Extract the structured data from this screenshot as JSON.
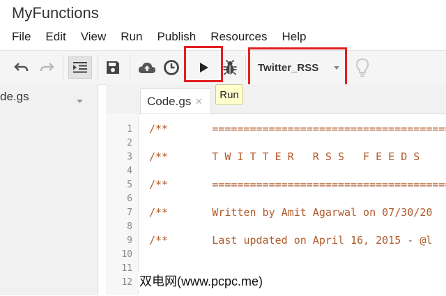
{
  "app": {
    "title": "MyFunctions"
  },
  "menu": [
    "File",
    "Edit",
    "View",
    "Run",
    "Publish",
    "Resources",
    "Help"
  ],
  "toolbar": {
    "undo_icon": "undo-icon",
    "redo_icon": "redo-icon",
    "indent_icon": "indent-icon",
    "save_icon": "save-icon",
    "cloud_icon": "cloud-upload-icon",
    "triggers_icon": "clock-icon",
    "run_icon": "play-icon",
    "debug_icon": "bug-icon",
    "function_select_value": "Twitter_RSS",
    "bulb_icon": "lightbulb-icon"
  },
  "tooltip": {
    "text": "Run"
  },
  "sidebar": {
    "file_label": "de.gs"
  },
  "tabs": [
    {
      "label": "Code.gs",
      "close": "×"
    }
  ],
  "code": {
    "line_numbers": [
      "1",
      "2",
      "3",
      "4",
      "5",
      "6",
      "7",
      "8",
      "9",
      "10",
      "11",
      "12"
    ],
    "lines": [
      "/**       =======================================",
      "",
      "/**       T W I T T E R   R S S   F E E D S",
      "",
      "/**       =======================================",
      "",
      "/**       Written by Amit Agarwal on 07/30/20",
      "",
      "/**       Last updated on April 16, 2015 - @l",
      "",
      "",
      ""
    ]
  },
  "watermark": "双电网(www.pcpc.me)",
  "colors": {
    "highlight": "#e02020",
    "code_comment": "#b05a2a"
  }
}
